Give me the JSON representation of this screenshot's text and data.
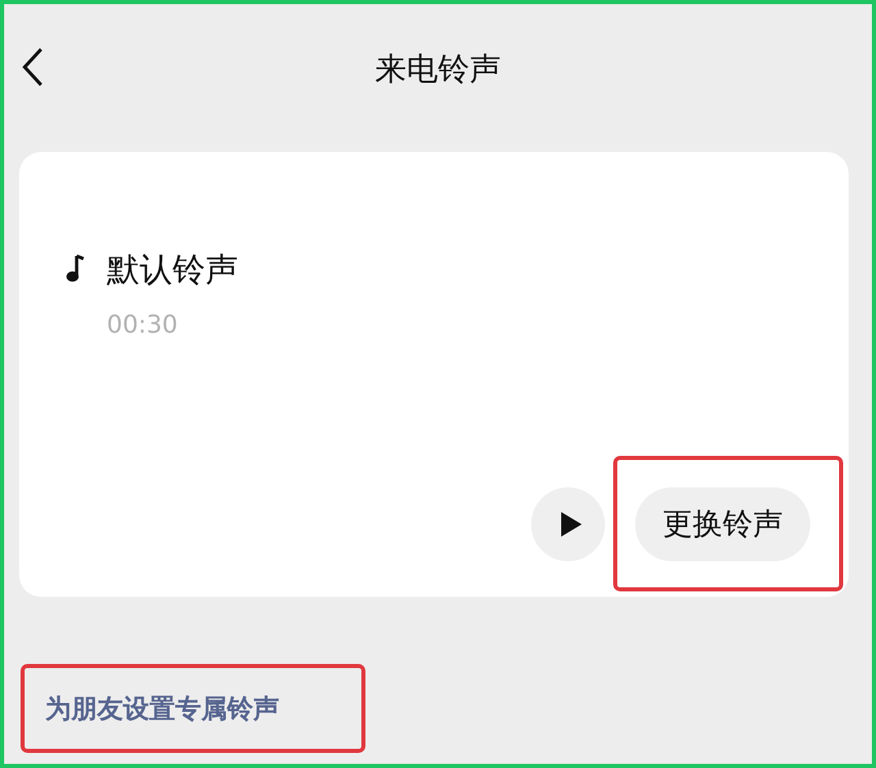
{
  "header": {
    "title": "来电铃声"
  },
  "ringtone": {
    "name": "默认铃声",
    "duration": "00:30",
    "change_button": {
      "label": "更换铃声",
      "highlighted": true
    }
  },
  "friend_link": {
    "label": "为朋友设置专属铃声",
    "highlighted": true
  }
}
